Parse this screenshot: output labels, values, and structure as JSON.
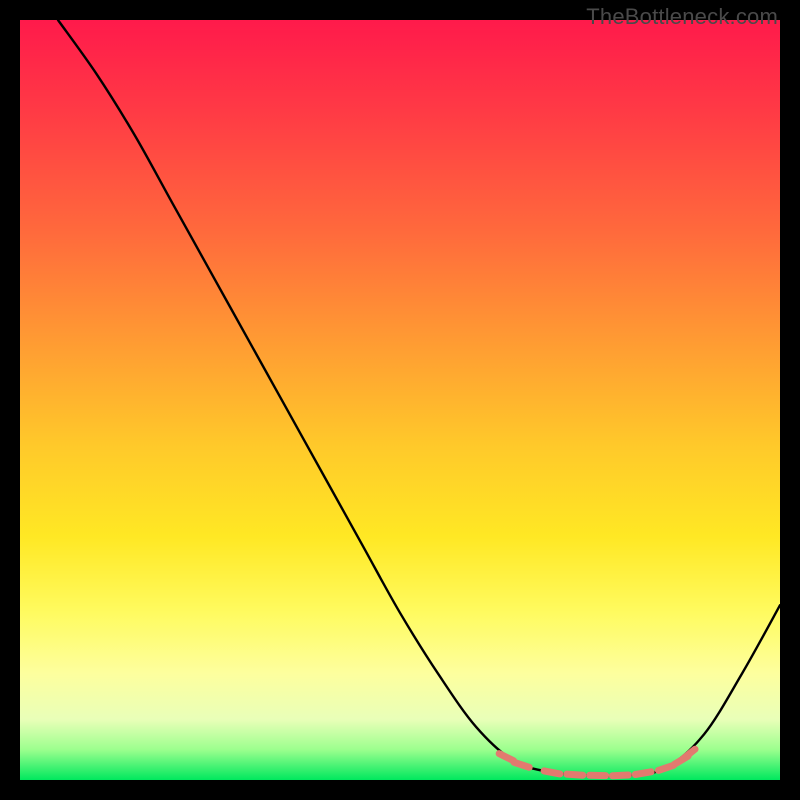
{
  "watermark": "TheBottleneck.com",
  "chart_data": {
    "type": "line",
    "title": "",
    "xlabel": "",
    "ylabel": "",
    "xlim": [
      0,
      100
    ],
    "ylim": [
      0,
      100
    ],
    "grid": false,
    "curve": [
      {
        "x": 5,
        "y": 100
      },
      {
        "x": 10,
        "y": 93
      },
      {
        "x": 15,
        "y": 85
      },
      {
        "x": 20,
        "y": 76
      },
      {
        "x": 25,
        "y": 67
      },
      {
        "x": 30,
        "y": 58
      },
      {
        "x": 35,
        "y": 49
      },
      {
        "x": 40,
        "y": 40
      },
      {
        "x": 45,
        "y": 31
      },
      {
        "x": 50,
        "y": 22
      },
      {
        "x": 55,
        "y": 14
      },
      {
        "x": 60,
        "y": 7
      },
      {
        "x": 65,
        "y": 2.5
      },
      {
        "x": 70,
        "y": 1
      },
      {
        "x": 75,
        "y": 0.6
      },
      {
        "x": 80,
        "y": 0.6
      },
      {
        "x": 85,
        "y": 1.6
      },
      {
        "x": 90,
        "y": 6
      },
      {
        "x": 95,
        "y": 14
      },
      {
        "x": 100,
        "y": 23
      }
    ],
    "optimal_band_x": [
      64,
      88
    ],
    "optimal_markers": [
      {
        "x": 64,
        "y": 3.0
      },
      {
        "x": 66,
        "y": 2.0
      },
      {
        "x": 70,
        "y": 1.0
      },
      {
        "x": 73,
        "y": 0.7
      },
      {
        "x": 76,
        "y": 0.6
      },
      {
        "x": 79,
        "y": 0.6
      },
      {
        "x": 82,
        "y": 0.9
      },
      {
        "x": 85,
        "y": 1.6
      },
      {
        "x": 87,
        "y": 2.6
      },
      {
        "x": 88,
        "y": 3.4
      }
    ],
    "colors": {
      "curve": "#000000",
      "marker": "#e27a6f",
      "bg_top": "#ff1a4b",
      "bg_bottom": "#00e85e"
    }
  }
}
